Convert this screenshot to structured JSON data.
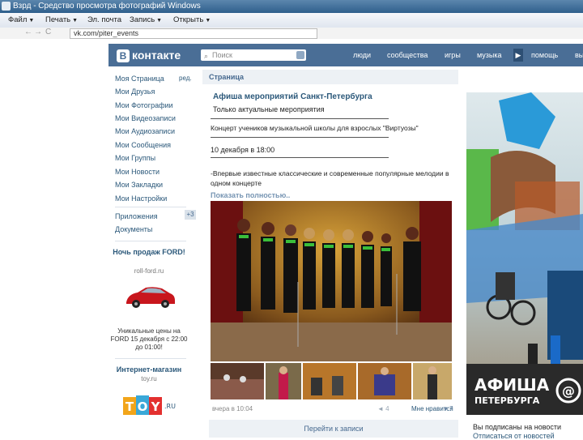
{
  "window": {
    "title": "Взрд - Средство просмотра фотографий Windows"
  },
  "menubar": {
    "items": [
      "Файл",
      "Печать",
      "Эл. почта",
      "Запись",
      "Открыть"
    ]
  },
  "addressbar": {
    "url": "vk.com/piter_events"
  },
  "vk": {
    "logo": "контакте",
    "logo_letter": "B",
    "search_placeholder": "Поиск",
    "nav": [
      "люди",
      "сообщества",
      "игры",
      "музыка",
      "помощь",
      "выйти"
    ]
  },
  "sidebar": {
    "items": [
      "Моя Страница",
      "Мои Друзья",
      "Мои Фотографии",
      "Мои Видеозаписи",
      "Мои Аудиозаписи",
      "Мои Сообщения",
      "Мои Группы",
      "Мои Новости",
      "Мои Закладки",
      "Мои Настройки"
    ],
    "edit_label": "ред.",
    "apps": [
      "Приложения",
      "Документы"
    ],
    "apps_badge": "+3",
    "ad1": {
      "title": "Ночь продаж FORD!",
      "site": "roll-ford.ru",
      "text": "Уникальные цены на FORD 15 декабря с 22:00 до 01:00!"
    },
    "ad2": {
      "title": "Интернет-магазин",
      "site": "toy.ru",
      "logo": "TOY",
      "logo_suffix": ".RU"
    }
  },
  "main": {
    "header": "Страница",
    "post_title": "Афиша мероприятий Санкт-Петербурга",
    "post_subtitle": "Только актуальные мероприятия",
    "line1": "Концерт учеников музыкальной школы для взрослых \"Виртуозы\"",
    "line2": "10 декабря в 18:00",
    "line3": "-Впервые известные классические и современные популярные мелодии в",
    "line4": "одном концерте",
    "show_full": "Показать полностью..",
    "date": "вчера в 10:04",
    "like_label": "Мне нравится",
    "like_count": "7",
    "repost_count": "4",
    "next_records": "Перейти к записи"
  },
  "right": {
    "poster_title": "АФИША",
    "poster_sub": "ПЕТЕРБУРГА",
    "poster_at": "@",
    "subscribed": "Вы подписаны на новости",
    "unsubscribe": "Отписаться от новостей"
  },
  "colors": {
    "vk_blue": "#4a6e96",
    "link_blue": "#2b587a"
  }
}
